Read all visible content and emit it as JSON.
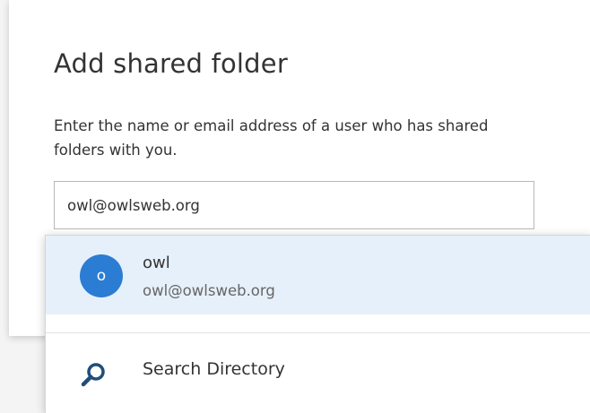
{
  "dialog": {
    "title": "Add shared folder",
    "description": "Enter the name or email address of a user who has shared folders with you.",
    "input_value": "owl@owlsweb.org"
  },
  "suggestions": {
    "items": [
      {
        "avatar_initial": "o",
        "name": "owl",
        "email": "owl@owlsweb.org"
      }
    ],
    "search_directory_label": "Search Directory"
  },
  "icons": {
    "search": "search-icon"
  },
  "colors": {
    "accent": "#2b7cd3",
    "hover_row": "#e6f0fa",
    "search_icon": "#1f4e79"
  }
}
